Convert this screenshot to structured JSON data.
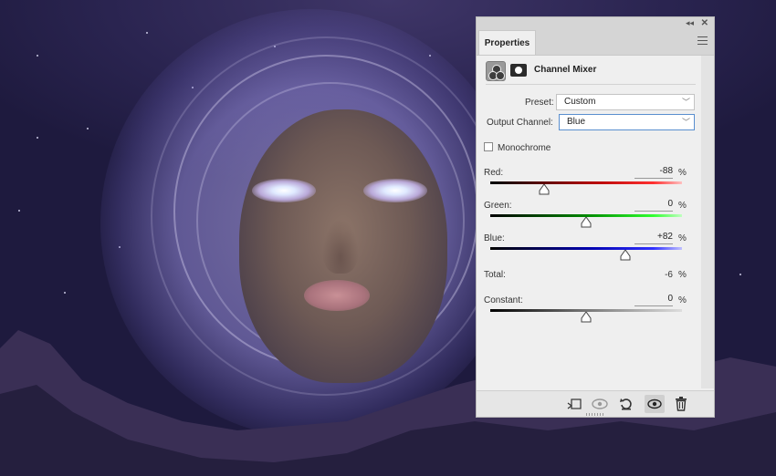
{
  "panel": {
    "tab_label": "Properties",
    "collapse_glyph": "◂◂",
    "close_glyph": "✕",
    "adjustment_title": "Channel Mixer",
    "adjustment_icon": "channel-mixer-icon",
    "mask_icon": "layer-mask-icon"
  },
  "preset": {
    "label": "Preset:",
    "value": "Custom"
  },
  "output_channel": {
    "label": "Output Channel:",
    "value": "Blue"
  },
  "monochrome": {
    "label": "Monochrome",
    "checked": false
  },
  "channels": {
    "red": {
      "label": "Red:",
      "value": "-88",
      "unit": "%",
      "numeric": -88,
      "color": "#cc2020"
    },
    "green": {
      "label": "Green:",
      "value": "0",
      "unit": "%",
      "numeric": 0,
      "color": "#22cc22"
    },
    "blue": {
      "label": "Blue:",
      "value": "+82",
      "unit": "%",
      "numeric": 82,
      "color": "#2020cc"
    }
  },
  "total": {
    "label": "Total:",
    "value": "-6",
    "unit": "%"
  },
  "constant": {
    "label": "Constant:",
    "value": "0",
    "unit": "%",
    "numeric": 0
  },
  "footer": {
    "buttons": [
      "clip-to-layer-icon",
      "view-previous-state-icon",
      "reset-icon",
      "visibility-eye-icon",
      "delete-icon"
    ]
  }
}
